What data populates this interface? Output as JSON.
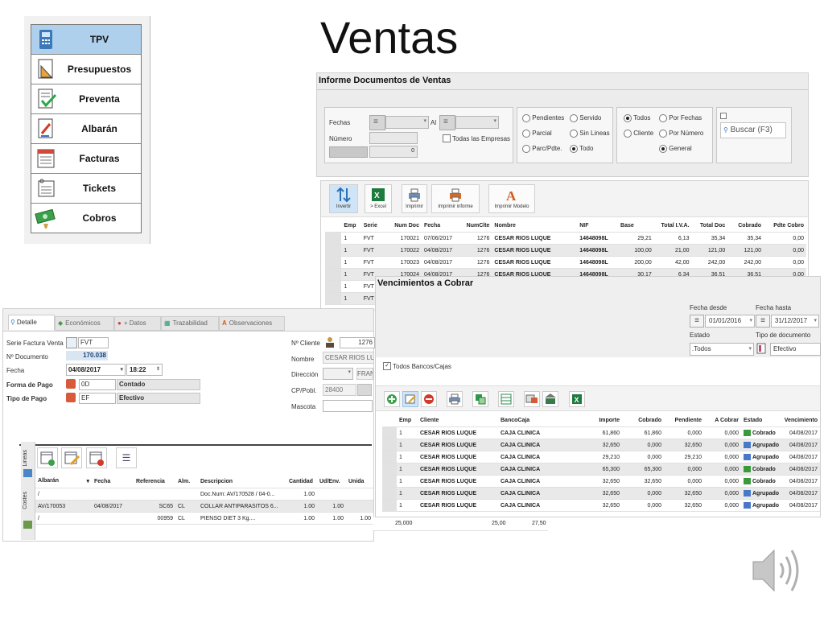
{
  "title": "Ventas",
  "sidebar": {
    "items": [
      {
        "label": "TPV",
        "icon": "pos-terminal-icon",
        "active": true
      },
      {
        "label": "Presupuestos",
        "icon": "document-ruler-icon"
      },
      {
        "label": "Preventa",
        "icon": "document-check-icon"
      },
      {
        "label": "Albarán",
        "icon": "delivery-note-icon"
      },
      {
        "label": "Facturas",
        "icon": "invoice-icon"
      },
      {
        "label": "Tickets",
        "icon": "ticket-icon"
      },
      {
        "label": "Cobros",
        "icon": "cash-icon"
      }
    ]
  },
  "informe": {
    "title": "Informe Documentos de Ventas",
    "filters": {
      "fechas_label": "Fechas",
      "al_label": "Al",
      "numero_label": "Número",
      "numero_value": "0",
      "todas_empresas_label": "Todas las Empresas",
      "radios_a": [
        "Pendientes",
        "Parcial",
        "Parc/Pdte."
      ],
      "radios_b": [
        "Servido",
        "Sin Lineas",
        "Todo"
      ],
      "radios_c": [
        "Todos",
        "Cliente"
      ],
      "radios_d": [
        "Por Fechas",
        "Por Número",
        "General"
      ],
      "search_label": "Buscar (F3)"
    },
    "toolbar": [
      "Invertir",
      "> Excel",
      "Imprimir",
      "Imprimir informe",
      "Imprimir Modelo"
    ],
    "columns": [
      "Emp",
      "Serie",
      "Num Doc",
      "Fecha",
      "NumClte",
      "Nombre",
      "NIF",
      "Base",
      "Total I.V.A.",
      "Total Doc",
      "Cobrado",
      "Pdte Cobro"
    ],
    "rows": [
      [
        "1",
        "FVT",
        "170021",
        "07/06/2017",
        "1276",
        "CESAR RIOS LUQUE",
        "14648098L",
        "29,21",
        "6,13",
        "35,34",
        "35,34",
        "0,00"
      ],
      [
        "1",
        "FVT",
        "170022",
        "04/08/2017",
        "1276",
        "CESAR RIOS LUQUE",
        "14648098L",
        "100,00",
        "21,00",
        "121,00",
        "121,00",
        "0,00"
      ],
      [
        "1",
        "FVT",
        "170023",
        "04/08/2017",
        "1276",
        "CESAR RIOS LUQUE",
        "14648098L",
        "200,00",
        "42,00",
        "242,00",
        "242,00",
        "0,00"
      ],
      [
        "1",
        "FVT",
        "170024",
        "04/08/2017",
        "1276",
        "CESAR RIOS LUQUE",
        "14648098L",
        "30,17",
        "6,34",
        "36,51",
        "36,51",
        "0,00"
      ],
      [
        "1",
        "FVT",
        "",
        "",
        "",
        "",
        "",
        "",
        "",
        "",
        "",
        ""
      ],
      [
        "1",
        "FVT",
        "",
        "",
        "",
        "",
        "",
        "",
        "",
        "",
        "",
        ""
      ]
    ]
  },
  "detalle": {
    "tabs": [
      "Detalle",
      "Económicos",
      "+ Datos",
      "Trazabilidad",
      "Observaciones"
    ],
    "serie_label": "Serie Factura Venta",
    "serie_value": "FVT",
    "ndoc_label": "Nº Documento",
    "ndoc_value": "170.038",
    "fecha_label": "Fecha",
    "fecha_value": "04/08/2017",
    "hora_value": "18:22",
    "forma_pago_label": "Forma de Pago",
    "forma_pago_code": "0D",
    "forma_pago_desc": "Contado",
    "tipo_pago_label": "Tipo de Pago",
    "tipo_pago_code": "EF",
    "tipo_pago_desc": "Efectivo",
    "ncliente_label": "Nº Cliente",
    "ncliente_value": "1276",
    "nombre_label": "Nombre",
    "nombre_value": "CESAR RIOS LUQU",
    "direccion_label": "Dirección",
    "direccion_value": "FRAN",
    "cp_label": "CP/Pobl.",
    "cp_value": "28400",
    "mascota_label": "Mascota",
    "side_tabs": [
      "Lineas",
      "Costes"
    ],
    "columns": [
      "Albarán",
      "Fecha",
      "Referencia",
      "Alm.",
      "Descripcion",
      "Cantidad",
      "Ud/Env.",
      "Unida"
    ],
    "rows": [
      [
        "/",
        "",
        "",
        "",
        "Doc.Num: AV/170528 / 04-0...",
        "1.00",
        "",
        ""
      ],
      [
        "AV/170053",
        "04/08/2017",
        "SC65",
        "CL",
        "COLLAR ANTIPARASITOS 6...",
        "1.00",
        "1.00",
        ""
      ],
      [
        "/",
        "",
        "00959",
        "CL",
        "PIENSO DIET 3 Kg....",
        "1.00",
        "1.00",
        "1.00"
      ]
    ],
    "row3_extra": [
      "25,000",
      "25,00",
      "27,50"
    ]
  },
  "vencimientos": {
    "title": "Vencimientos a Cobrar",
    "fecha_desde_label": "Fecha desde",
    "fecha_desde_value": "01/01/2016",
    "fecha_hasta_label": "Fecha hasta",
    "fecha_hasta_value": "31/12/2017",
    "estado_label": "Estado",
    "estado_value": ".Todos",
    "tipo_doc_label": "Tipo de documento",
    "tipo_doc_value": "Efectivo",
    "todos_bancos_label": "Todos Bancos/Cajas",
    "columns": [
      "Emp",
      "Cliente",
      "BancoCaja",
      "Importe",
      "Cobrado",
      "Pendiente",
      "A Cobrar",
      "Estado",
      "Vencimiento"
    ],
    "rows": [
      [
        "1",
        "CESAR RIOS LUQUE",
        "CAJA CLINICA",
        "61,860",
        "61,860",
        "0,000",
        "0,000",
        "Cobrado",
        "04/08/2017"
      ],
      [
        "1",
        "CESAR RIOS LUQUE",
        "CAJA CLINICA",
        "32,650",
        "0,000",
        "32,650",
        "0,000",
        "Agrupado",
        "04/08/2017"
      ],
      [
        "1",
        "CESAR RIOS LUQUE",
        "CAJA CLINICA",
        "29,210",
        "0,000",
        "29,210",
        "0,000",
        "Agrupado",
        "04/08/2017"
      ],
      [
        "1",
        "CESAR RIOS LUQUE",
        "CAJA CLINICA",
        "65,300",
        "65,300",
        "0,000",
        "0,000",
        "Cobrado",
        "04/08/2017"
      ],
      [
        "1",
        "CESAR RIOS LUQUE",
        "CAJA CLINICA",
        "32,650",
        "32,650",
        "0,000",
        "0,000",
        "Cobrado",
        "04/08/2017"
      ],
      [
        "1",
        "CESAR RIOS LUQUE",
        "CAJA CLINICA",
        "32,650",
        "0,000",
        "32,650",
        "0,000",
        "Agrupado",
        "04/08/2017"
      ],
      [
        "1",
        "CESAR RIOS LUQUE",
        "CAJA CLINICA",
        "32,650",
        "0,000",
        "32,650",
        "0,000",
        "Agrupado",
        "04/08/2017"
      ]
    ]
  }
}
